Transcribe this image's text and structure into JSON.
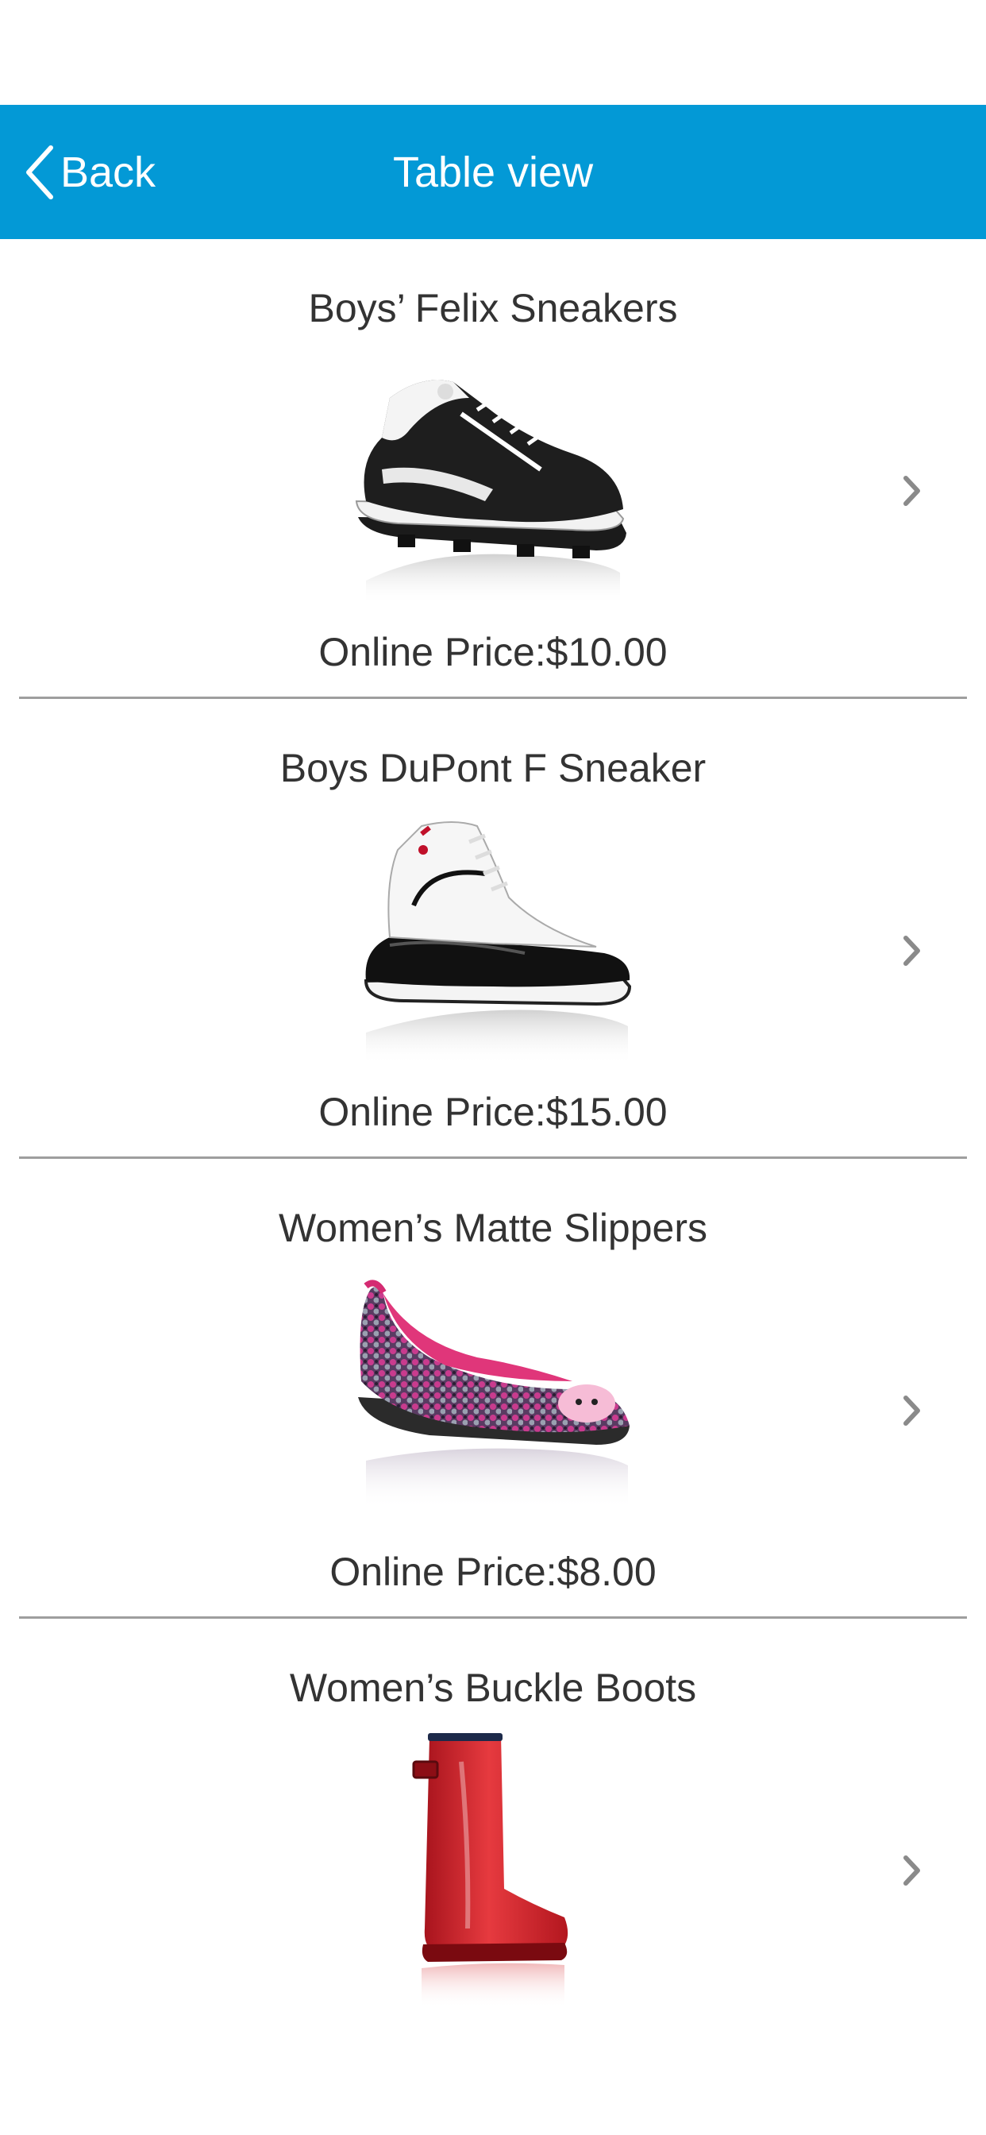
{
  "nav": {
    "back_label": "Back",
    "title": "Table view"
  },
  "colors": {
    "nav_background": "#0399d6",
    "text": "#333333",
    "divider": "#9e9e9e",
    "chevron": "#8a8a8a"
  },
  "products": [
    {
      "name": "Boys’ Felix Sneakers",
      "price": "Online Price:$10.00",
      "image": "black-white-cleat-sneaker"
    },
    {
      "name": "Boys DuPont F Sneaker",
      "price": "Online Price:$15.00",
      "image": "white-black-high-top-sneaker"
    },
    {
      "name": "Women’s Matte Slippers",
      "price": "Online Price:$8.00",
      "image": "pink-sequin-flat-slipper"
    },
    {
      "name": "Women’s Buckle Boots",
      "price": "",
      "image": "red-rain-boot"
    }
  ]
}
